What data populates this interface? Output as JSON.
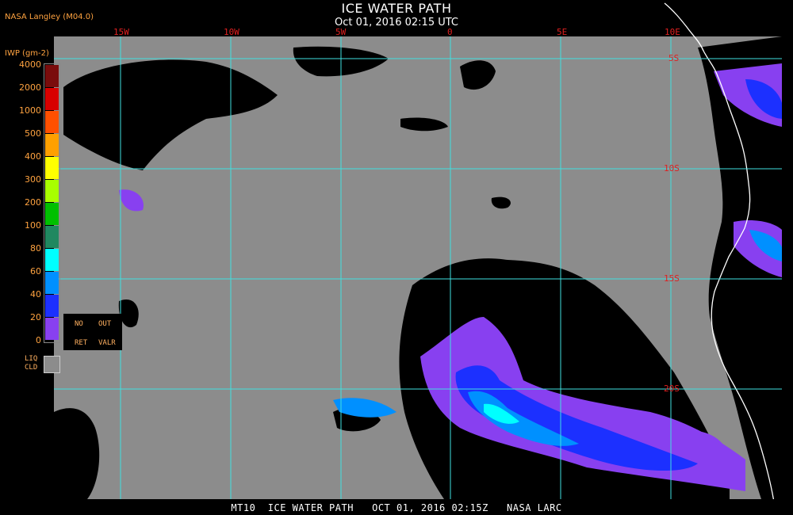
{
  "title": "ICE WATER PATH",
  "subtitle": "Oct 01, 2016 02:15 UTC",
  "producer": "NASA Langley (M04.0)",
  "footer": "MT10  ICE WATER PATH   OCT 01, 2016 02:15Z   NASA LARC",
  "colors": {
    "liquid_cloud": "#8c8c8c",
    "clear": "#000000",
    "grid": "#40e0e0",
    "coastline": "#ffffff",
    "label": "#e02020",
    "legend_text": "#ffa340"
  },
  "map": {
    "longitude_labels": [
      "15W",
      "10W",
      "5W",
      "0",
      "5E",
      "10E"
    ],
    "latitude_labels": [
      "5S",
      "10S",
      "15S",
      "20S"
    ]
  },
  "legend": {
    "title": "IWP (gm-2)",
    "ticks": [
      "4000",
      "2000",
      "1000",
      "500",
      "400",
      "300",
      "200",
      "100",
      "80",
      "60",
      "40",
      "20",
      "0"
    ],
    "bins": [
      {
        "color": "#7a0c0c"
      },
      {
        "color": "#d80000"
      },
      {
        "color": "#ff5000"
      },
      {
        "color": "#ffa000"
      },
      {
        "color": "#ffff00"
      },
      {
        "color": "#a8ff00"
      },
      {
        "color": "#00c000"
      },
      {
        "color": "#208860"
      },
      {
        "color": "#00ffff"
      },
      {
        "color": "#0090ff"
      },
      {
        "color": "#1c30ff"
      },
      {
        "color": "#8840f0"
      }
    ],
    "no_retrieval": {
      "line1": "NO",
      "line2": "RET"
    },
    "out_of_range": {
      "line1": "OUT",
      "line2": "VALR"
    },
    "liquid_cloud_label": {
      "line1": "LIQ",
      "line2": "CLD"
    }
  }
}
